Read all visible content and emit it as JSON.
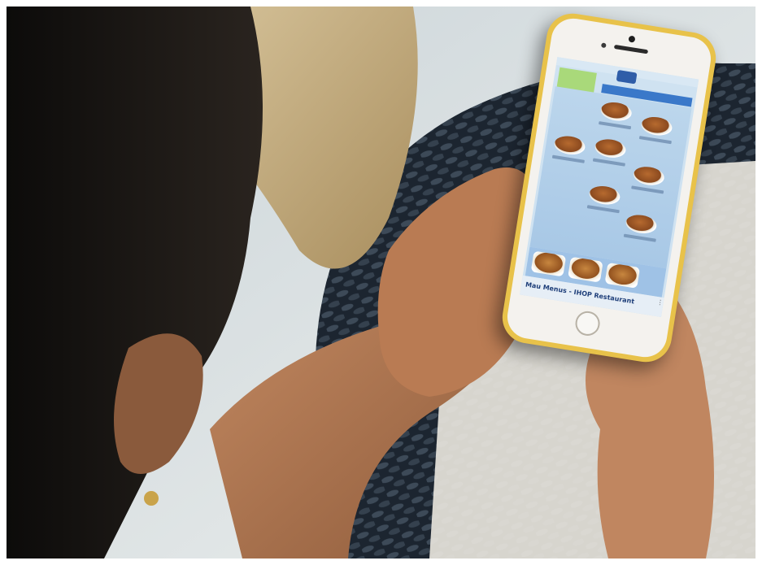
{
  "scene": {
    "subject": "person-holding-smartphone",
    "phone": {
      "case_color": "#e8c24a",
      "body_color": "#f4f2ee",
      "screen_bg": "#cfe2f1",
      "accent_blue": "#3a78c9",
      "screen": {
        "menu_title": "Mau Menus - IHOP Restaurant"
      }
    }
  }
}
